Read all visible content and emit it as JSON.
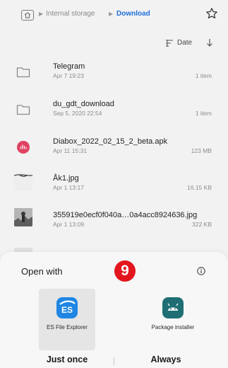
{
  "breadcrumb": {
    "items": [
      "Internal storage",
      "Download"
    ]
  },
  "sort": {
    "label": "Date"
  },
  "files": [
    {
      "name": "Telegram",
      "date": "Apr 7 19:23",
      "meta": "1 item",
      "icon": "folder-icon"
    },
    {
      "name": "du_gdt_download",
      "date": "Sep 5, 2020 22:54",
      "meta": "1 item",
      "icon": "folder-icon"
    },
    {
      "name": "Diabox_2022_02_15_2_beta.apk",
      "date": "Apr 11 15:31",
      "meta": "123 MB",
      "icon": "apk-icon"
    },
    {
      "name": "Åk1.jpg",
      "date": "Apr 1 13:17",
      "meta": "16.15 KB",
      "icon": "image-thumbnail"
    },
    {
      "name": "355919e0ecf0f040a…0a4acc8924636.jpg",
      "date": "Apr 1 13:09",
      "meta": "322 KB",
      "icon": "image-thumbnail"
    },
    {
      "name": "",
      "date": "",
      "meta": "",
      "icon": "image-thumbnail"
    }
  ],
  "sheet": {
    "title": "Open with",
    "badge": "9",
    "apps": [
      {
        "label": "ES File Explorer",
        "icon": "es-file-explorer-icon"
      },
      {
        "label": "Package installer",
        "icon": "android-icon"
      }
    ],
    "buttons": {
      "just_once": "Just once",
      "always": "Always"
    }
  },
  "colors": {
    "accent": "#1e6fd9",
    "badge": "#e3161d",
    "es_icon": "#1f86e4",
    "package_icon": "#1f6e74"
  }
}
